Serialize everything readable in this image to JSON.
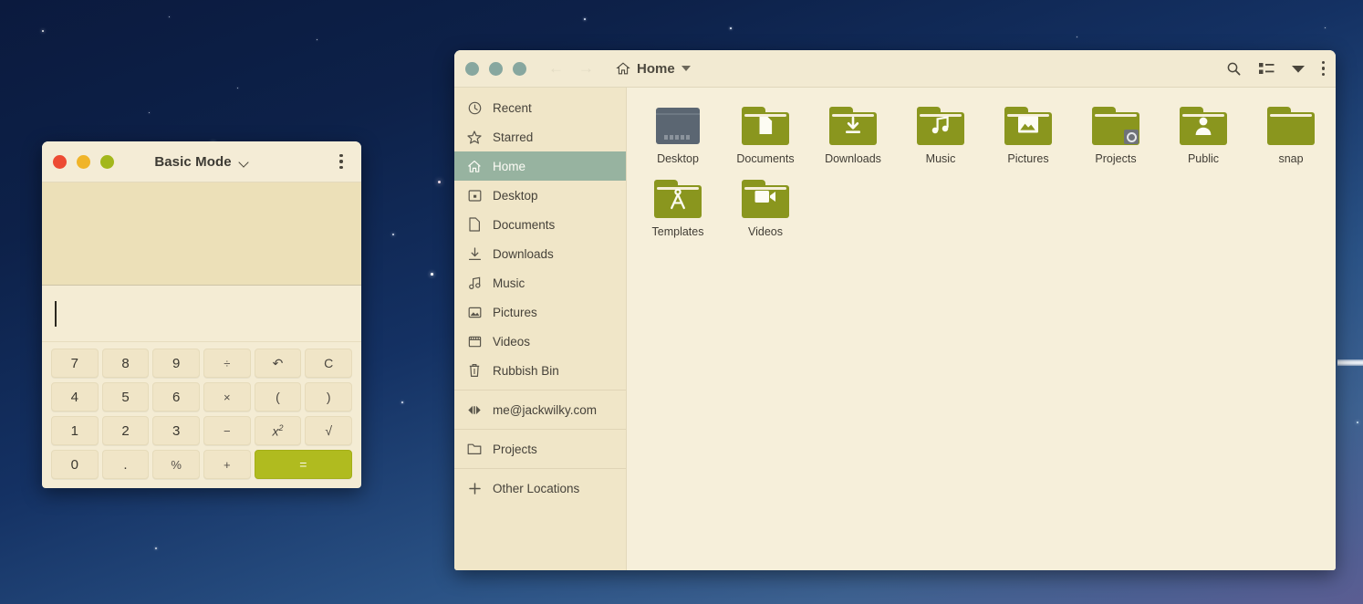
{
  "desktop": {
    "wallpaper": "starry-night-gradient",
    "top_color": "#0b1a3e",
    "bottom_color": "#5b5d92"
  },
  "calculator": {
    "title": "Basic Mode",
    "window_controls": {
      "close": "close",
      "minimize": "minimize",
      "maximize": "maximize"
    },
    "menu_label": "menu",
    "display_value": "",
    "entry_value": "",
    "accent_color": "#b0bb1f",
    "keys": [
      {
        "label": "7",
        "kind": "num",
        "name": "key-7"
      },
      {
        "label": "8",
        "kind": "num",
        "name": "key-8"
      },
      {
        "label": "9",
        "kind": "num",
        "name": "key-9"
      },
      {
        "label": "÷",
        "kind": "op",
        "name": "key-divide"
      },
      {
        "label": "↶",
        "kind": "sym",
        "name": "key-undo"
      },
      {
        "label": "C",
        "kind": "sym",
        "name": "key-clear"
      },
      {
        "label": "4",
        "kind": "num",
        "name": "key-4"
      },
      {
        "label": "5",
        "kind": "num",
        "name": "key-5"
      },
      {
        "label": "6",
        "kind": "num",
        "name": "key-6"
      },
      {
        "label": "×",
        "kind": "op",
        "name": "key-multiply"
      },
      {
        "label": "(",
        "kind": "sym",
        "name": "key-paren-open"
      },
      {
        "label": ")",
        "kind": "sym",
        "name": "key-paren-close"
      },
      {
        "label": "1",
        "kind": "num",
        "name": "key-1"
      },
      {
        "label": "2",
        "kind": "num",
        "name": "key-2"
      },
      {
        "label": "3",
        "kind": "num",
        "name": "key-3"
      },
      {
        "label": "−",
        "kind": "op",
        "name": "key-subtract"
      },
      {
        "label": "x2",
        "kind": "pow",
        "name": "key-square"
      },
      {
        "label": "√",
        "kind": "sym",
        "name": "key-sqrt"
      },
      {
        "label": "0",
        "kind": "num",
        "name": "key-0"
      },
      {
        "label": ".",
        "kind": "num",
        "name": "key-decimal"
      },
      {
        "label": "%",
        "kind": "op",
        "name": "key-percent"
      },
      {
        "label": "+",
        "kind": "op",
        "name": "key-add"
      },
      {
        "label": "=",
        "kind": "eq",
        "name": "key-equals"
      }
    ]
  },
  "files": {
    "title": "Home",
    "toolbar": {
      "back_label": "←",
      "forward_label": "→",
      "search_label": "Search",
      "view_label": "List view",
      "view_dropdown_label": "View options",
      "menu_label": "Main menu"
    },
    "sidebar": {
      "items": [
        {
          "label": "Recent",
          "icon": "clock-icon",
          "name": "sidebar-item-recent",
          "selected": false
        },
        {
          "label": "Starred",
          "icon": "star-icon",
          "name": "sidebar-item-starred",
          "selected": false
        },
        {
          "label": "Home",
          "icon": "home-icon",
          "name": "sidebar-item-home",
          "selected": true
        },
        {
          "label": "Desktop",
          "icon": "desktop-icon",
          "name": "sidebar-item-desktop",
          "selected": false
        },
        {
          "label": "Documents",
          "icon": "document-icon",
          "name": "sidebar-item-documents",
          "selected": false
        },
        {
          "label": "Downloads",
          "icon": "download-icon",
          "name": "sidebar-item-downloads",
          "selected": false
        },
        {
          "label": "Music",
          "icon": "music-note-icon",
          "name": "sidebar-item-music",
          "selected": false
        },
        {
          "label": "Pictures",
          "icon": "image-icon",
          "name": "sidebar-item-pictures",
          "selected": false
        },
        {
          "label": "Videos",
          "icon": "video-icon",
          "name": "sidebar-item-videos",
          "selected": false
        },
        {
          "label": "Rubbish Bin",
          "icon": "trash-icon",
          "name": "sidebar-item-rubbish-bin",
          "selected": false
        },
        {
          "label": "me@jackwilky.com",
          "icon": "network-connect-icon",
          "name": "sidebar-item-network-account",
          "selected": false
        },
        {
          "label": "Projects",
          "icon": "folder-icon",
          "name": "sidebar-item-projects",
          "selected": false
        },
        {
          "label": "Other Locations",
          "icon": "plus-icon",
          "name": "sidebar-item-other-locations",
          "selected": false
        }
      ],
      "selected_color": "#97b3a0"
    },
    "folder_color": "#8a961e",
    "items": [
      {
        "label": "Desktop",
        "icon": "monitor",
        "glyph": "",
        "name": "file-item-desktop"
      },
      {
        "label": "Documents",
        "icon": "folder",
        "glyph": "🗎",
        "name": "file-item-documents"
      },
      {
        "label": "Downloads",
        "icon": "folder",
        "glyph": "⭳",
        "name": "file-item-downloads"
      },
      {
        "label": "Music",
        "icon": "folder",
        "glyph": "♫",
        "name": "file-item-music"
      },
      {
        "label": "Pictures",
        "icon": "folder",
        "glyph": "▣",
        "name": "file-item-pictures"
      },
      {
        "label": "Projects",
        "icon": "folder",
        "glyph": "",
        "emblem": true,
        "name": "file-item-projects"
      },
      {
        "label": "Public",
        "icon": "folder",
        "glyph": "👤",
        "name": "file-item-public"
      },
      {
        "label": "snap",
        "icon": "folder",
        "glyph": "",
        "name": "file-item-snap"
      },
      {
        "label": "Templates",
        "icon": "folder",
        "glyph": "✐",
        "name": "file-item-templates"
      },
      {
        "label": "Videos",
        "icon": "folder",
        "glyph": "▶",
        "name": "file-item-videos"
      }
    ]
  }
}
